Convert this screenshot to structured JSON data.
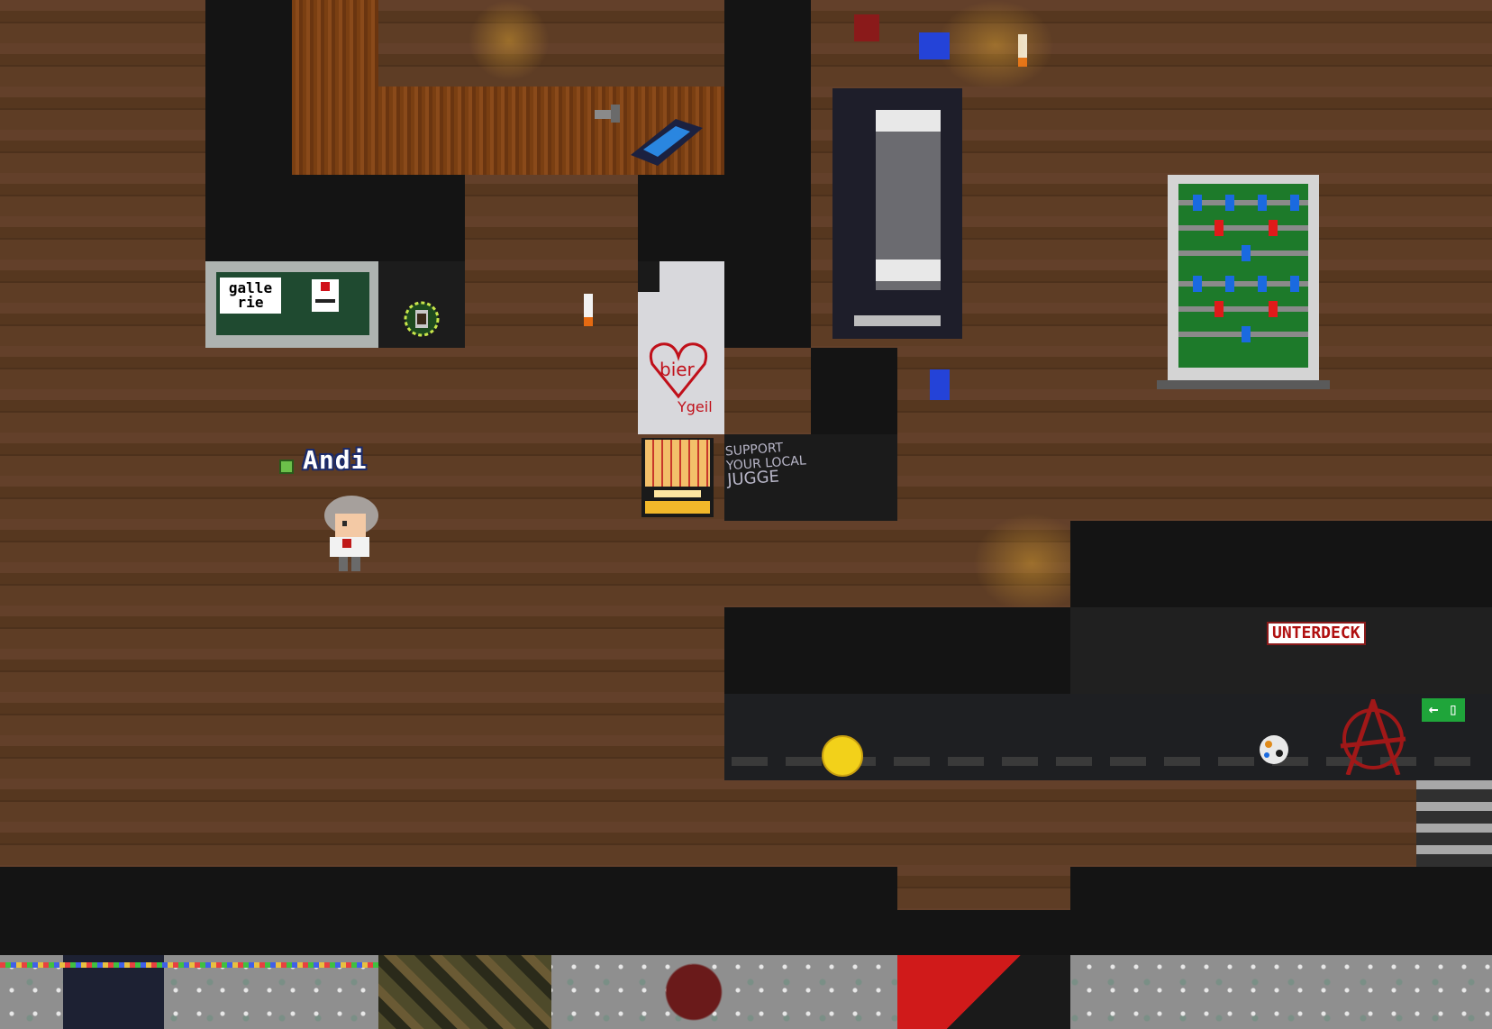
{
  "player": {
    "name": "Andi",
    "status_color": "#6cc04a"
  },
  "signs": {
    "gallerie_line1": "galle",
    "gallerie_line2": "rie",
    "fridge_heart": "bier",
    "fridge_tag": "Ygeil",
    "chalk_line1": "SUPPORT",
    "chalk_line2": "YOUR LOCAL",
    "chalk_line3": "JUGGE",
    "unterdeck": "UNTERDECK"
  },
  "icons": {
    "anarchy": "anarchy-symbol-icon",
    "exit": "exit-sign-icon",
    "coin": "coin-icon"
  },
  "colors": {
    "floor": "#5c3b23",
    "wall": "#141414",
    "accent_red": "#b01010",
    "exit_green": "#1fa53a"
  }
}
